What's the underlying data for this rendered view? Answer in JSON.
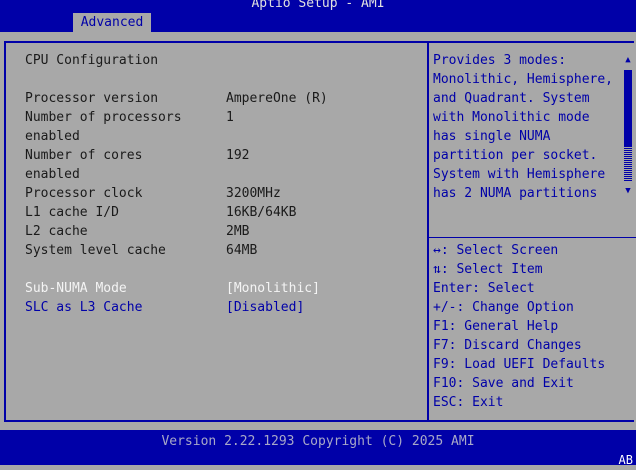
{
  "header": {
    "title": "Aptio Setup - AMI",
    "tab": "Advanced"
  },
  "main": {
    "section_title": "CPU Configuration",
    "info": [
      {
        "label": "Processor version",
        "value": "AmpereOne (R)"
      },
      {
        "label": "Number of processors\nenabled",
        "value": "1"
      },
      {
        "label": "Number of cores\nenabled",
        "value": "192"
      },
      {
        "label": "Processor clock",
        "value": "3200MHz"
      },
      {
        "label": "L1 cache I/D",
        "value": "16KB/64KB"
      },
      {
        "label": "L2 cache",
        "value": "2MB"
      },
      {
        "label": "System level cache",
        "value": "64MB"
      }
    ],
    "options": [
      {
        "label": "Sub-NUMA Mode",
        "value": "[Monolithic]"
      },
      {
        "label": "SLC as L3 Cache",
        "value": "[Disabled]"
      }
    ]
  },
  "help": {
    "lines": [
      "Provides 3 modes:",
      "Monolithic, Hemisphere,",
      "and Quadrant. System",
      "with Monolithic mode",
      "has single NUMA",
      "partition per socket.",
      "System with Hemisphere",
      "has 2 NUMA partitions"
    ],
    "scroll_position": 0.0
  },
  "keys": [
    "↔: Select Screen",
    "⇅: Select Item",
    "Enter: Select",
    "+/-: Change Option",
    "F1: General Help",
    "F7: Discard Changes",
    "F9: Load UEFI Defaults",
    "F10: Save and Exit",
    "ESC: Exit"
  ],
  "footer": {
    "version": "Version 2.22.1293 Copyright (C) 2025 AMI",
    "indicator": "AB"
  }
}
